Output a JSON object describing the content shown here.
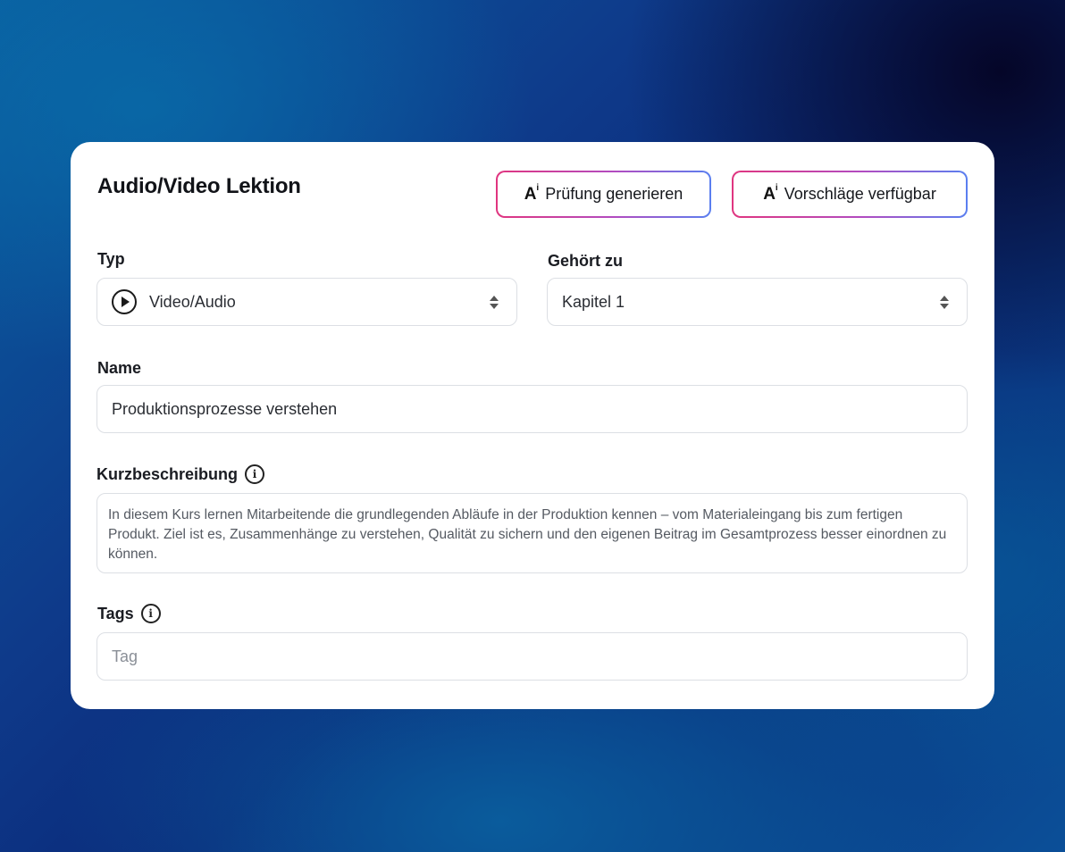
{
  "card": {
    "title": "Audio/Video Lektion",
    "buttons": {
      "generate_exam": {
        "icon": "ai-sparkle-icon",
        "label": "Prüfung generieren"
      },
      "suggestions": {
        "icon": "ai-sparkle-icon",
        "label": "Vorschläge verfügbar"
      }
    },
    "ai_glyph": "A",
    "ai_glyph_sup": "i",
    "type": {
      "label": "Typ",
      "value": "Video/Audio",
      "icon": "play-circle-icon"
    },
    "belongs_to": {
      "label": "Gehört zu",
      "value": "Kapitel 1"
    },
    "name": {
      "label": "Name",
      "value": "Produktionsprozesse verstehen"
    },
    "short_description": {
      "label": "Kurzbeschreibung",
      "info_icon": "info-icon",
      "value": "In diesem Kurs lernen Mitarbeitende die grundlegenden Abläufe in der Produktion kennen – vom Materialeingang bis zum fertigen Produkt. Ziel ist es, Zusammenhänge zu verstehen, Qualität zu sichern und den eigenen Beitrag im Gesamtprozess besser einordnen zu können."
    },
    "tags": {
      "label": "Tags",
      "info_icon": "info-icon",
      "placeholder": "Tag"
    },
    "info_glyph": "i"
  },
  "colors": {
    "button_gradient_start": "#e0357f",
    "button_gradient_end": "#5a7ff0",
    "card_background": "#ffffff"
  }
}
